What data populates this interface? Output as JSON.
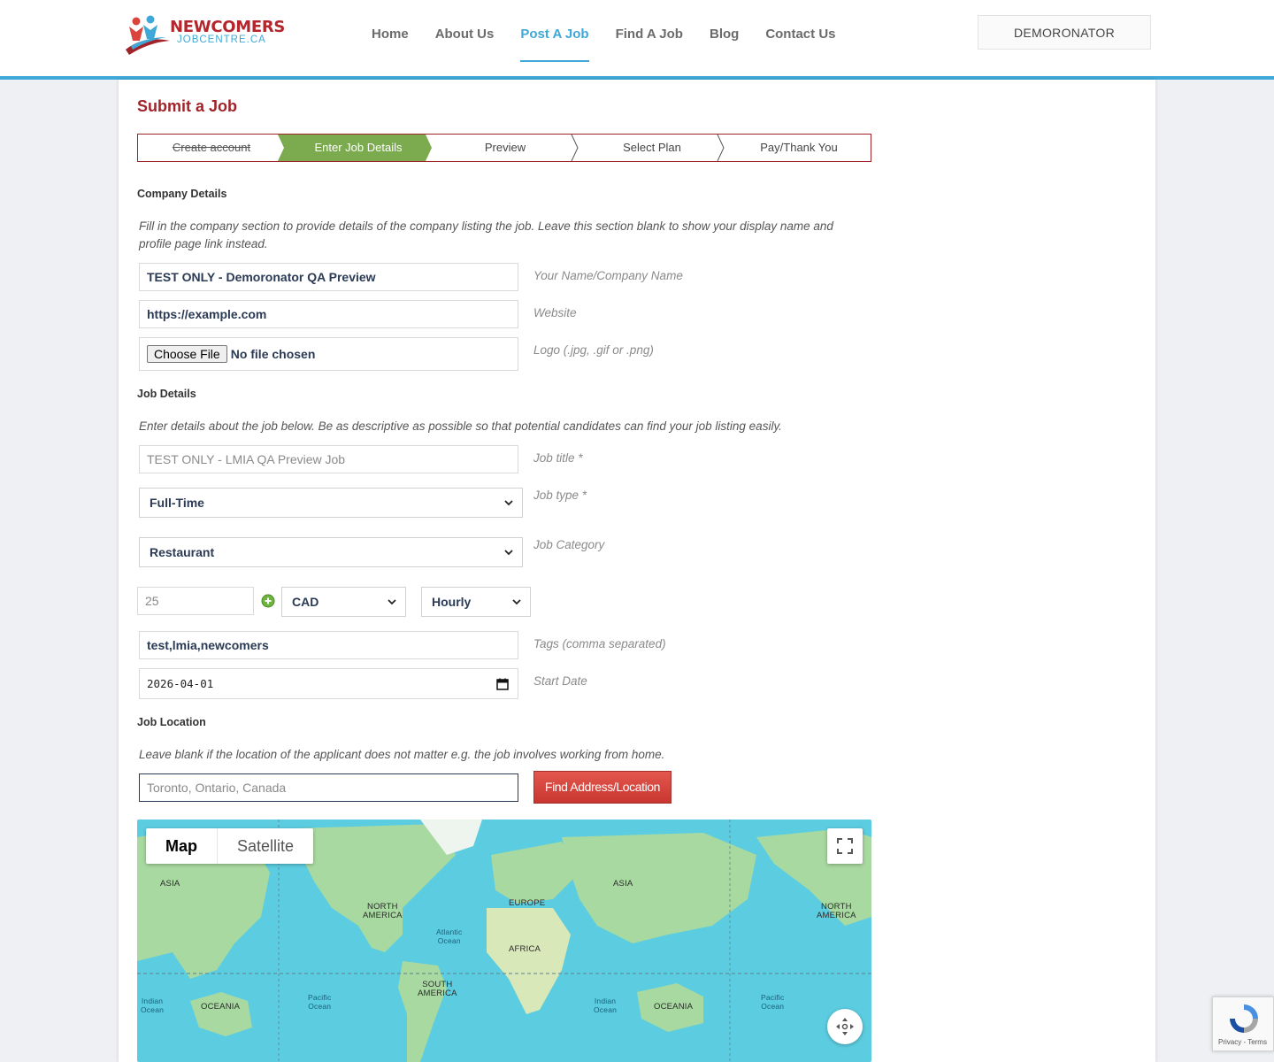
{
  "header": {
    "logo": {
      "line1": "NEWCOMERS",
      "line2": "JOBCENTRE.CA"
    },
    "nav": [
      {
        "label": "Home",
        "active": false
      },
      {
        "label": "About Us",
        "active": false
      },
      {
        "label": "Post A Job",
        "active": true
      },
      {
        "label": "Find A Job",
        "active": false
      },
      {
        "label": "Blog",
        "active": false
      },
      {
        "label": "Contact Us",
        "active": false
      }
    ],
    "user_button": "DEMORONATOR"
  },
  "page": {
    "title": "Submit a Job",
    "steps": [
      {
        "label": "Create account",
        "state": "done"
      },
      {
        "label": "Enter Job Details",
        "state": "current"
      },
      {
        "label": "Preview",
        "state": "upcoming"
      },
      {
        "label": "Select Plan",
        "state": "upcoming"
      },
      {
        "label": "Pay/Thank You",
        "state": "upcoming"
      }
    ]
  },
  "company": {
    "heading": "Company Details",
    "help": "Fill in the company section to provide details of the company listing the job. Leave this section blank to show your display name and profile page link instead.",
    "name_value": "TEST ONLY - Demoronator QA Preview",
    "name_label": "Your Name/Company Name",
    "website_value": "https://example.com",
    "website_label": "Website",
    "logo_button": "Choose File",
    "logo_status": "No file chosen",
    "logo_label": "Logo (.jpg, .gif or .png)"
  },
  "job": {
    "heading": "Job Details",
    "help": "Enter details about the job below. Be as descriptive as possible so that potential candidates can find your job listing easily.",
    "title_placeholder": "TEST ONLY - LMIA QA Preview Job",
    "title_label": "Job title *",
    "type_value": "Full-Time",
    "type_label": "Job type *",
    "category_value": "Restaurant",
    "category_label": "Job Category",
    "salary_placeholder": "25",
    "currency_value": "CAD",
    "period_value": "Hourly",
    "tags_value": "test,lmia,newcomers",
    "tags_label": "Tags (comma separated)",
    "start_date_value": "2026-04-01",
    "start_date_label": "Start Date"
  },
  "location": {
    "heading": "Job Location",
    "help": "Leave blank if the location of the applicant does not matter e.g. the job involves working from home.",
    "address_placeholder": "Toronto, Ontario, Canada",
    "find_button": "Find Address/Location"
  },
  "map": {
    "toggle_map": "Map",
    "toggle_satellite": "Satellite",
    "labels": {
      "asia_left": "ASIA",
      "north_america": "NORTH\nAMERICA",
      "europe": "EUROPE",
      "asia": "ASIA",
      "north_america_right": "NORTH\nAMERICA",
      "atlantic": "Atlantic\nOcean",
      "africa": "AFRICA",
      "south_america": "SOUTH\nAMERICA",
      "indian_left": "Indian\nOcean",
      "oceania_left": "OCEANIA",
      "pacific_left": "Pacific\nOcean",
      "indian": "Indian\nOcean",
      "oceania": "OCEANIA",
      "pacific_right": "Pacific\nOcean"
    },
    "land_color": "#a8d9a0",
    "water_color": "#5ccde0"
  },
  "recaptcha": {
    "terms": "Privacy - Terms"
  },
  "colors": {
    "brand_red": "#a0232a",
    "accent_blue": "#3fa8d8",
    "step_green": "#7cab4f",
    "button_red": "#d9453d"
  }
}
